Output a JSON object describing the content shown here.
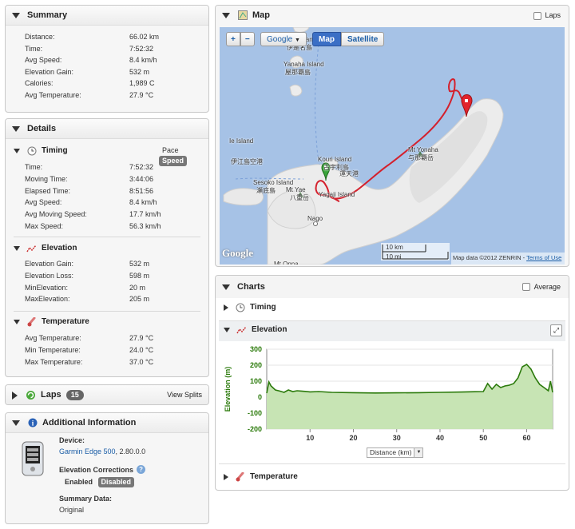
{
  "summary": {
    "title": "Summary",
    "rows": [
      {
        "label": "Distance:",
        "value": "66.02 km"
      },
      {
        "label": "Time:",
        "value": "7:52:32"
      },
      {
        "label": "Avg Speed:",
        "value": "8.4 km/h"
      },
      {
        "label": "Elevation Gain:",
        "value": "532 m"
      },
      {
        "label": "Calories:",
        "value": "1,989 C"
      },
      {
        "label": "Avg Temperature:",
        "value": "27.9 °C"
      }
    ]
  },
  "details": {
    "title": "Details",
    "timing": {
      "title": "Timing",
      "pace_label": "Pace",
      "speed_label": "Speed",
      "rows": [
        {
          "label": "Time:",
          "value": "7:52:32"
        },
        {
          "label": "Moving Time:",
          "value": "3:44:06"
        },
        {
          "label": "Elapsed Time:",
          "value": "8:51:56"
        },
        {
          "label": "Avg Speed:",
          "value": "8.4 km/h"
        },
        {
          "label": "Avg Moving Speed:",
          "value": "17.7 km/h"
        },
        {
          "label": "Max Speed:",
          "value": "56.3 km/h"
        }
      ]
    },
    "elevation": {
      "title": "Elevation",
      "rows": [
        {
          "label": "Elevation Gain:",
          "value": "532 m"
        },
        {
          "label": "Elevation Loss:",
          "value": "598 m"
        },
        {
          "label": "MinElevation:",
          "value": "20 m"
        },
        {
          "label": "MaxElevation:",
          "value": "205 m"
        }
      ]
    },
    "temperature": {
      "title": "Temperature",
      "rows": [
        {
          "label": "Avg Temperature:",
          "value": "27.9 °C"
        },
        {
          "label": "Min Temperature:",
          "value": "24.0 °C"
        },
        {
          "label": "Max Temperature:",
          "value": "37.0 °C"
        }
      ]
    }
  },
  "laps": {
    "title": "Laps",
    "count": "15",
    "view_splits": "View Splits"
  },
  "additional": {
    "title": "Additional Information",
    "device_label": "Device:",
    "device_link": "Garmin Edge 500",
    "device_version": ", 2.80.0.0",
    "elev_corr_label": "Elevation Corrections",
    "enabled": "Enabled",
    "disabled": "Disabled",
    "summary_data_label": "Summary Data:",
    "summary_data_value": "Original"
  },
  "map": {
    "title": "Map",
    "laps_label": "Laps",
    "zoom_in": "+",
    "zoom_out": "−",
    "provider_select": "Google",
    "type_map": "Map",
    "type_satellite": "Satellite",
    "scale_km": "10 km",
    "scale_mi": "10 mi",
    "attribution": "Map data ©2012 ZENRIN -",
    "terms": "Terms of Use",
    "logo": "Google",
    "places": [
      {
        "name": "Izena Island"
      },
      {
        "name": "伊是名島"
      },
      {
        "name": "Yanaha Island"
      },
      {
        "name": "屋那覇島"
      },
      {
        "name": "Ie Island"
      },
      {
        "name": "伊江島空港"
      },
      {
        "name": "Kouri Island"
      },
      {
        "name": "古宇利島"
      },
      {
        "name": "運天港"
      },
      {
        "name": "Sesoko Island"
      },
      {
        "name": "瀬底島"
      },
      {
        "name": "Mt Yae"
      },
      {
        "name": "八重岳"
      },
      {
        "name": "Yagaji Island"
      },
      {
        "name": "Nago"
      },
      {
        "name": "Mt Yonaha"
      },
      {
        "name": "与那覇岳"
      },
      {
        "name": "Mt Onna"
      }
    ]
  },
  "charts": {
    "title": "Charts",
    "average_label": "Average",
    "timing_label": "Timing",
    "elevation_label": "Elevation",
    "temperature_label": "Temperature",
    "xaxis_select": "Distance (km)"
  },
  "chart_data": {
    "type": "area",
    "xlabel": "Distance (km)",
    "ylabel": "Elevation (m)",
    "xlim": [
      0,
      66
    ],
    "ylim": [
      -200,
      300
    ],
    "xticks": [
      10,
      20,
      30,
      40,
      50,
      60
    ],
    "yticks": [
      300,
      200,
      100,
      0,
      -100,
      -200
    ],
    "x": [
      0,
      0.5,
      1,
      2,
      3,
      4,
      5,
      6,
      7,
      8,
      10,
      12,
      15,
      20,
      25,
      30,
      35,
      40,
      45,
      48,
      50,
      51,
      52,
      53,
      54,
      55,
      56,
      57,
      58,
      59,
      60,
      61,
      62,
      63,
      64,
      65,
      65.5,
      66
    ],
    "y": [
      25,
      95,
      70,
      45,
      38,
      30,
      45,
      35,
      40,
      38,
      33,
      35,
      30,
      28,
      26,
      27,
      28,
      30,
      32,
      34,
      35,
      85,
      50,
      80,
      60,
      70,
      75,
      85,
      120,
      190,
      205,
      175,
      120,
      80,
      60,
      40,
      100,
      30
    ],
    "series": [
      {
        "values_ref": "y",
        "color": "#2b7a0b",
        "fill": "#c7e4b4"
      }
    ]
  },
  "colors": {
    "accent": "#555555",
    "route": "#d4202c",
    "elevation_line": "#2b7a0b",
    "link": "#1a5da6"
  }
}
